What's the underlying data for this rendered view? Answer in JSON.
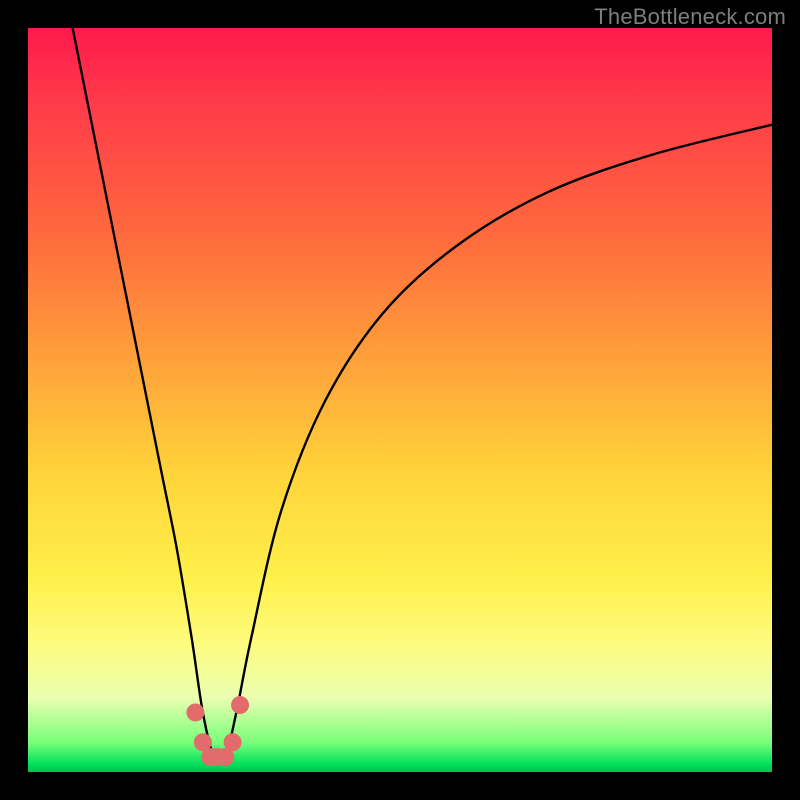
{
  "watermark": "TheBottleneck.com",
  "chart_data": {
    "type": "line",
    "title": "",
    "xlabel": "",
    "ylabel": "",
    "xlim": [
      0,
      100
    ],
    "ylim": [
      0,
      100
    ],
    "grid": false,
    "legend": false,
    "series": [
      {
        "name": "bottleneck-curve",
        "x": [
          6,
          8,
          10,
          12,
          14,
          16,
          18,
          20,
          22,
          23.5,
          25,
          26.5,
          28,
          30,
          34,
          40,
          48,
          58,
          70,
          84,
          100
        ],
        "y": [
          100,
          90,
          80,
          70,
          60,
          50,
          40,
          30,
          18,
          8,
          2,
          2,
          8,
          18,
          35,
          50,
          62,
          71,
          78,
          83,
          87
        ]
      }
    ],
    "markers": {
      "name": "highlight-points",
      "color": "#e26b6b",
      "x": [
        22.5,
        23.5,
        24.5,
        25,
        25.5,
        26.5,
        27.5,
        28.5
      ],
      "y": [
        8,
        4,
        2,
        2,
        2,
        2,
        4,
        9
      ]
    }
  },
  "colors": {
    "curve": "#000000",
    "marker": "#e26b6b",
    "background_top": "#ff1a4d",
    "background_bottom": "#00c048",
    "frame": "#000000",
    "watermark": "#7e7e7e"
  }
}
